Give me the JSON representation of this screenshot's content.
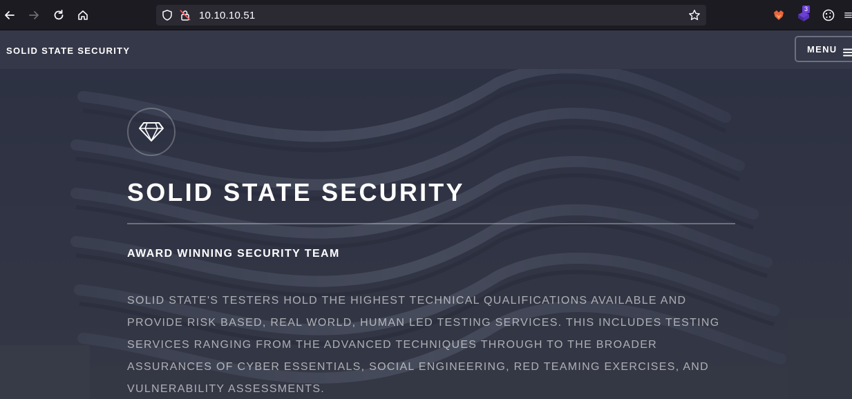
{
  "browser": {
    "url": "10.10.10.51",
    "extension_badge": "3",
    "icons": [
      "back-arrow-icon",
      "forward-arrow-icon",
      "reload-icon",
      "home-icon",
      "shield-icon",
      "insecure-lock-icon",
      "bookmark-star-icon",
      "fox-extension-icon",
      "purple-extension-icon",
      "cookie-icon",
      "overflow-menu-icon"
    ]
  },
  "header": {
    "title": "SOLID STATE SECURITY",
    "menu_label": "MENU"
  },
  "hero": {
    "icon": "diamond-icon",
    "title": "SOLID STATE SECURITY",
    "subtitle": "AWARD WINNING SECURITY TEAM",
    "body": "SOLID STATE'S TESTERS HOLD THE HIGHEST TECHNICAL QUALIFICATIONS AVAILABLE AND PROVIDE RISK BASED, REAL WORLD, HUMAN LED TESTING SERVICES. THIS INCLUDES TESTING SERVICES RANGING FROM THE ADVANCED TECHNIQUES THROUGH TO THE BROADER ASSURANCES OF CYBER ESSENTIALS, SOCIAL ENGINEERING, RED TEAMING EXERCISES, AND VULNERABILITY ASSESSMENTS."
  },
  "colors": {
    "browser_toolbar": "#1c1b22",
    "url_field": "#2b2a33",
    "site_header": "#353849",
    "hero_overlay": "#2e3141",
    "text": "#ffffff"
  }
}
